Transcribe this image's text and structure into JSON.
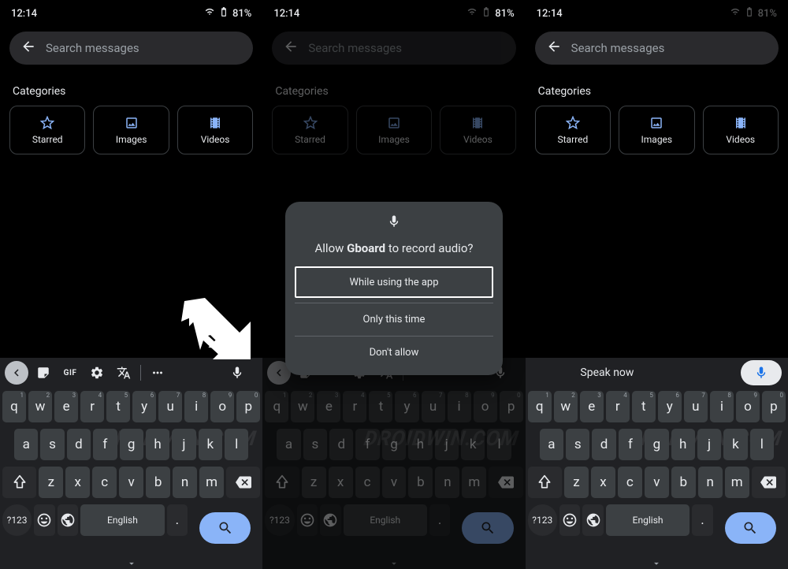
{
  "status": {
    "time": "12:14",
    "battery": "81%"
  },
  "search": {
    "placeholder": "Search messages"
  },
  "categories": {
    "label": "Categories",
    "items": [
      {
        "name": "starred",
        "label": "Starred"
      },
      {
        "name": "images",
        "label": "Images"
      },
      {
        "name": "videos",
        "label": "Videos"
      }
    ]
  },
  "keyboard": {
    "row1": [
      {
        "k": "q",
        "h": "1"
      },
      {
        "k": "w",
        "h": "2"
      },
      {
        "k": "e",
        "h": "3"
      },
      {
        "k": "r",
        "h": "4"
      },
      {
        "k": "t",
        "h": "5"
      },
      {
        "k": "y",
        "h": "6"
      },
      {
        "k": "u",
        "h": "7"
      },
      {
        "k": "i",
        "h": "8"
      },
      {
        "k": "o",
        "h": "9"
      },
      {
        "k": "p",
        "h": "0"
      }
    ],
    "row2": [
      "a",
      "s",
      "d",
      "f",
      "g",
      "h",
      "j",
      "k",
      "l"
    ],
    "row3": [
      "z",
      "x",
      "c",
      "v",
      "b",
      "n",
      "m"
    ],
    "sym": "?123",
    "space": "English",
    "period": "."
  },
  "toolbar": {
    "gif": "GIF"
  },
  "speak": {
    "label": "Speak now"
  },
  "dialog": {
    "title_pre": "Allow ",
    "title_bold": "Gboard",
    "title_post": " to record audio?",
    "opt1": "While using the app",
    "opt2": "Only this time",
    "opt3": "Don't allow"
  },
  "watermark": "DROIDWIN.COM"
}
